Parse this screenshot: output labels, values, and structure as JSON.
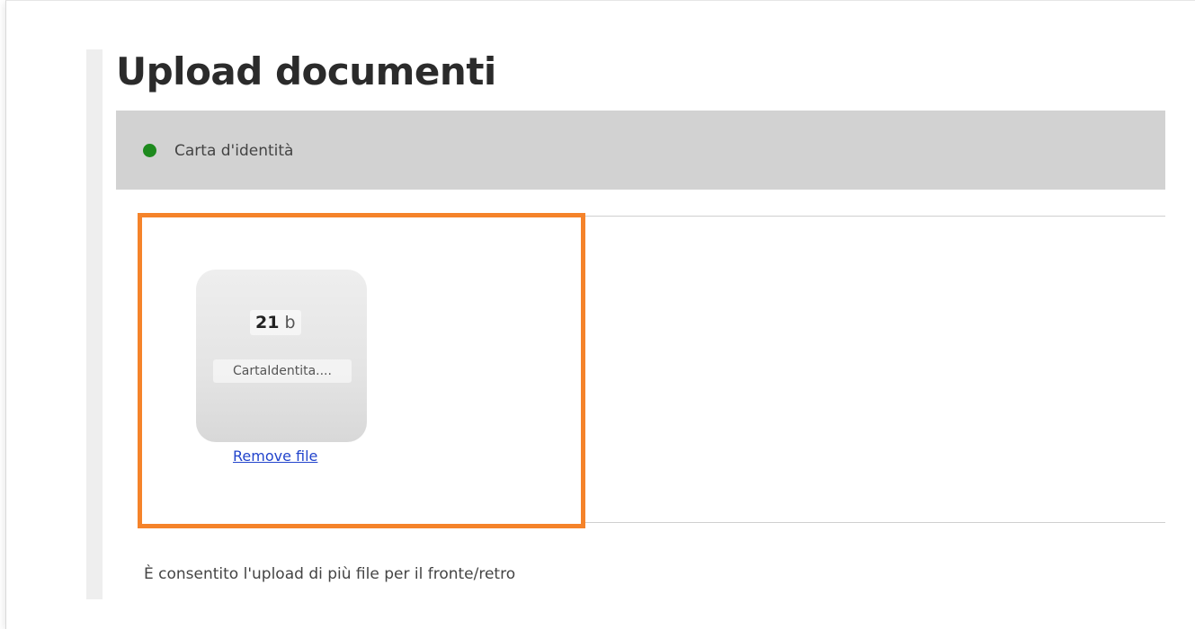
{
  "page": {
    "title": "Upload documenti"
  },
  "document": {
    "label": "Carta d'identità",
    "status_color": "#1e8a1e"
  },
  "file": {
    "size_value": "21",
    "size_unit": "b",
    "name": "CartaIdentita....",
    "remove_label": "Remove file"
  },
  "hint": "È consentito l'upload di più file per il fronte/retro",
  "colors": {
    "highlight": "#f5832a",
    "header_bg": "#d2d2d2",
    "link": "#2244cc"
  }
}
